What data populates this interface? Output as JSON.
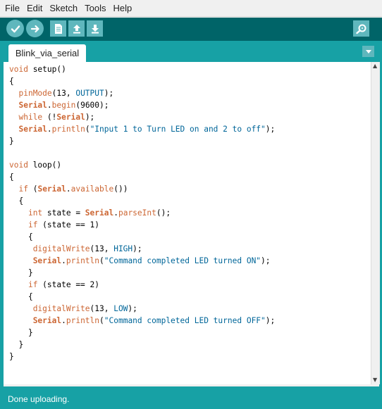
{
  "menu": {
    "items": [
      {
        "label": "File"
      },
      {
        "label": "Edit"
      },
      {
        "label": "Sketch"
      },
      {
        "label": "Tools"
      },
      {
        "label": "Help"
      }
    ]
  },
  "toolbar": {
    "buttons": [
      {
        "name": "verify-button",
        "icon": "checkmark-icon"
      },
      {
        "name": "upload-button",
        "icon": "arrow-right-icon"
      },
      {
        "name": "new-button",
        "icon": "document-icon"
      },
      {
        "name": "open-button",
        "icon": "arrow-up-icon"
      },
      {
        "name": "save-button",
        "icon": "arrow-down-icon"
      },
      {
        "name": "serial-monitor-button",
        "icon": "magnifier-icon"
      }
    ]
  },
  "tabs": [
    {
      "label": "Blink_via_serial",
      "active": true
    }
  ],
  "editor": {
    "lines": [
      "void setup()",
      "{",
      "  pinMode(13, OUTPUT);",
      "  Serial.begin(9600);",
      "  while (!Serial);",
      "  Serial.println(\"Input 1 to Turn LED on and 2 to off\");",
      "}",
      "",
      "void loop()",
      "{",
      "  if (Serial.available())",
      "  {",
      "    int state = Serial.parseInt();",
      "    if (state == 1)",
      "    {",
      "     digitalWrite(13, HIGH);",
      "     Serial.println(\"Command completed LED turned ON\");",
      "    }",
      "    if (state == 2)",
      "    {",
      "     digitalWrite(13, LOW);",
      "     Serial.println(\"Command completed LED turned OFF\");",
      "    }",
      "  }",
      "}"
    ]
  },
  "status": {
    "text": "Done uploading."
  },
  "colors": {
    "toolbar": "#006468",
    "accent": "#17a1a5",
    "button": "#5fb7bd",
    "keyword": "#cc6633",
    "constant": "#006699"
  }
}
